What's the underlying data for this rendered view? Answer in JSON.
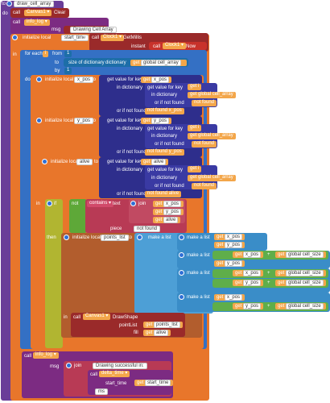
{
  "procedure": {
    "keyword": "to",
    "name": "draw_cell_array",
    "do": "do"
  },
  "call_clear": {
    "call": "call",
    "component": "Canvas1",
    "method": "Clear"
  },
  "call_log1": {
    "call": "call",
    "proc": "info_log",
    "arg": "msg",
    "text": "Drawing Cell Array"
  },
  "init_start": {
    "label": "initialize local",
    "var": "start_time",
    "to": "to",
    "call": "call",
    "component": "Clock1",
    "method": "GetMillis",
    "arg": "instant",
    "call2": "call",
    "component2": "Clock1",
    "method2": "Now"
  },
  "in1": "in",
  "for_each": {
    "label": "for each",
    "var": "i",
    "from": "from",
    "from_val": "1",
    "to": "to",
    "size_label": "size of dictionary",
    "dict": "dictionary",
    "get": "get",
    "global_cell_array": "global cell_array",
    "by": "by",
    "by_val": "1"
  },
  "do2": "do",
  "x_pos": {
    "label": "initialize local",
    "var": "x_pos",
    "to": "to",
    "gv": "get value for key",
    "get": "get",
    "key": "x_pos",
    "in_dict": "in dictionary",
    "get_i": "get",
    "i": "i",
    "get_ca": "get",
    "ca": "global cell_array",
    "not_found": "or if not found",
    "nf1": "not found",
    "nf2": "not found x_pos"
  },
  "y_pos": {
    "label": "initialize local",
    "var": "y_pos",
    "to": "to",
    "gv": "get value for key",
    "get": "get",
    "key": "y_pos",
    "in_dict": "in dictionary",
    "get_i": "get",
    "i": "i",
    "get_ca": "get",
    "ca": "global cell_array",
    "not_found": "or if not found",
    "nf1": "not found",
    "nf2": "not found y_pos"
  },
  "alive": {
    "label": "initialize local",
    "var": "alive",
    "to": "to",
    "gv": "get value for key",
    "get": "get",
    "key": "alive",
    "in_dict": "in dictionary",
    "get_i": "get",
    "i": "i",
    "get_ca": "get",
    "ca": "global cell_array",
    "not_found": "or if not found",
    "nf1": "not found",
    "nf2": "not found alive"
  },
  "in2": "in",
  "if_block": {
    "if": "if",
    "not": "not",
    "contains": "contains",
    "text_arg": "text",
    "join": "join",
    "get_x": "x_pos",
    "get_y": "y_pos",
    "get_alive": "alive",
    "piece": "piece",
    "piece_val": "not found",
    "get": "get"
  },
  "then": "then",
  "points_list": {
    "label": "initialize local",
    "var": "points_list",
    "to": "to",
    "make_a_list": "make a list",
    "get": "get",
    "x": "x_pos",
    "y": "y_pos",
    "plus": "+",
    "size": "global cell_size"
  },
  "in3": "in",
  "draw_shape": {
    "call": "call",
    "component": "Canvas1",
    "method": "DrawShape",
    "pointList": "pointList",
    "get_points": "points_list",
    "fill": "fill",
    "get_alive": "alive",
    "get": "get"
  },
  "call_log2": {
    "call": "call",
    "proc": "info_log",
    "arg": "msg",
    "join": "join",
    "text": "Drawing successful in: ",
    "call2": "call",
    "proc2": "delta_time",
    "start_time": "start_time",
    "get": "get",
    "get_start": "start_time",
    "ms": "ms"
  }
}
